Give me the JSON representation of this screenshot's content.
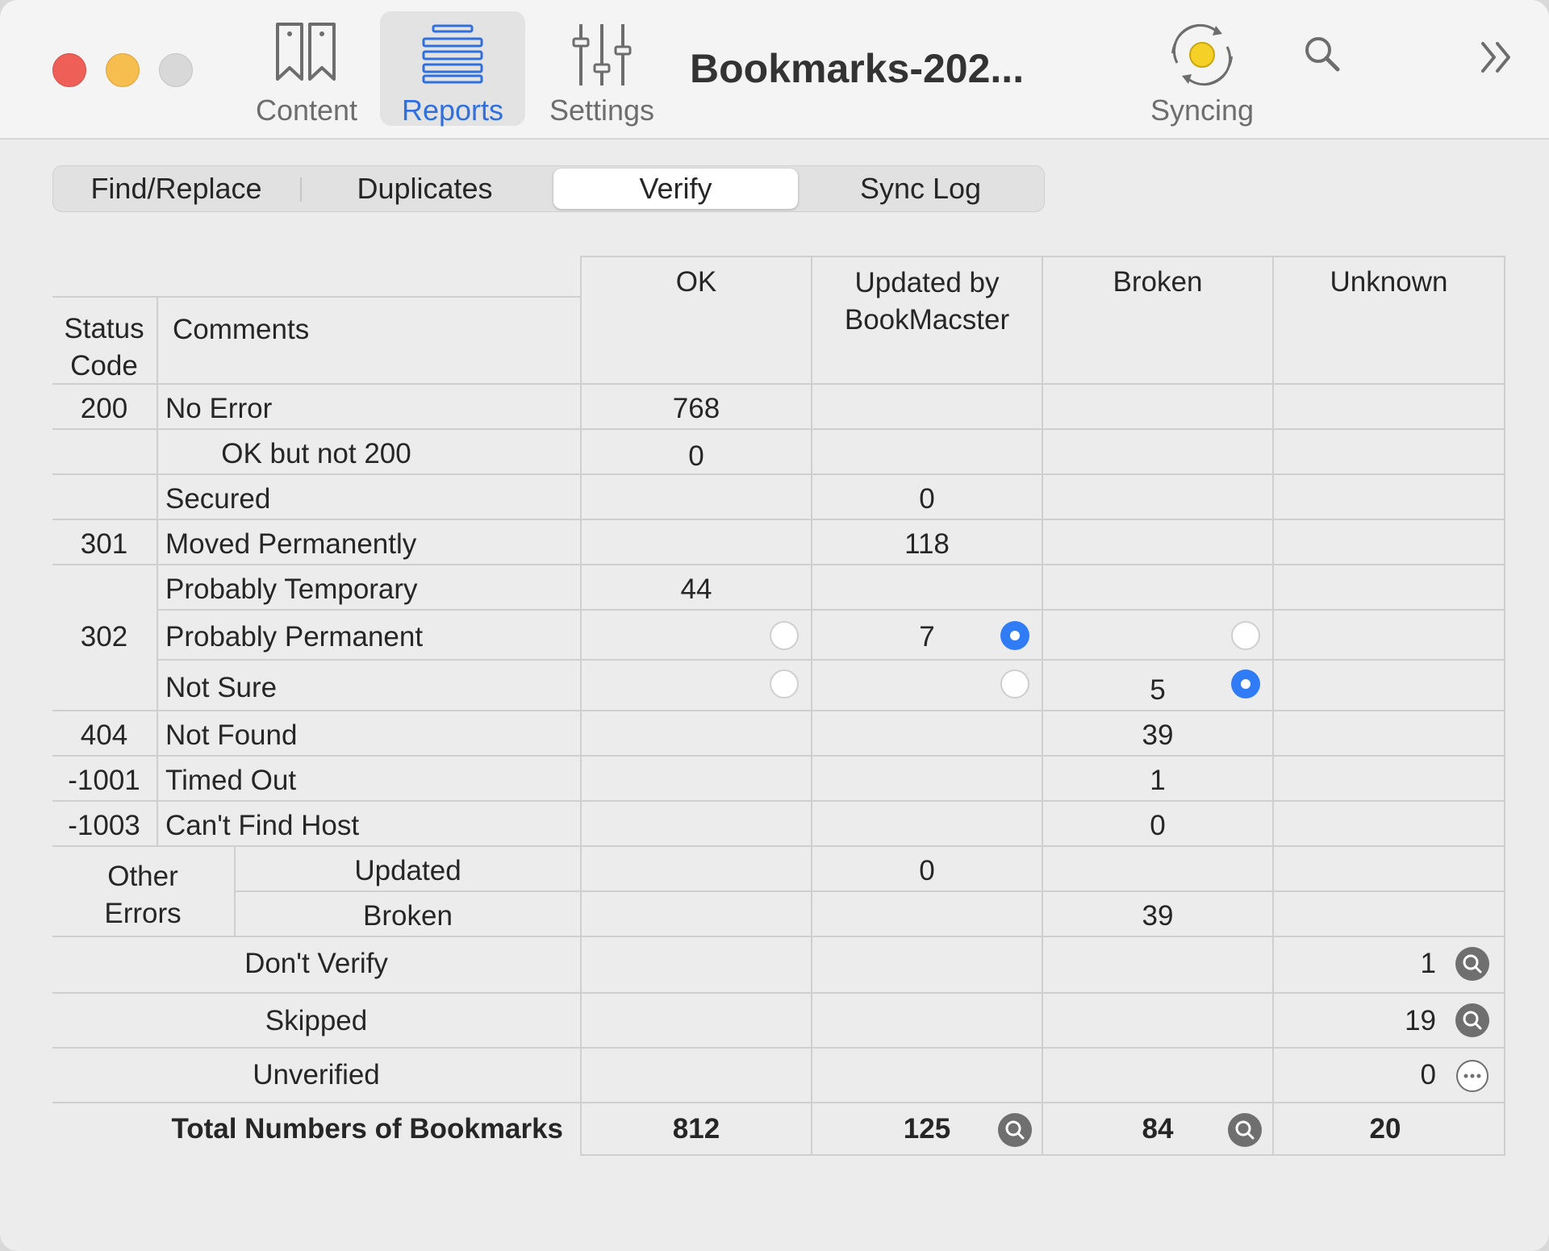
{
  "toolbar": {
    "content_label": "Content",
    "reports_label": "Reports",
    "settings_label": "Settings",
    "doc_title": "Bookmarks-202...",
    "syncing_label": "Syncing",
    "accent": "#2f6fde"
  },
  "tabs": [
    "Find/Replace",
    "Duplicates",
    "Verify",
    "Sync Log"
  ],
  "active_tab": "Verify",
  "table": {
    "columns": {
      "status_code": "Status\nCode",
      "comments": "Comments",
      "ok": "OK",
      "updated": "Updated by\nBookMacster",
      "broken": "Broken",
      "unknown": "Unknown"
    },
    "rows": [
      {
        "code": "200",
        "comment": "No Error",
        "ok": "768"
      },
      {
        "comment": "OK but not 200",
        "ok": "0"
      },
      {
        "comment": "Secured",
        "updated": "0"
      },
      {
        "code": "301",
        "comment": "Moved Permanently",
        "updated": "118"
      },
      {
        "code": "302",
        "comment": "Probably Temporary",
        "ok": "44"
      },
      {
        "comment": "Probably Permanent",
        "updated": "7"
      },
      {
        "comment": "Not Sure",
        "broken": "5"
      },
      {
        "code": "404",
        "comment": "Not Found",
        "broken": "39"
      },
      {
        "code": "-1001",
        "comment": "Timed Out",
        "broken": "1"
      },
      {
        "code": "-1003",
        "comment": "Can't Find Host",
        "broken": "0"
      },
      {
        "group": "Other\nErrors",
        "comment": "Updated",
        "updated": "0"
      },
      {
        "comment": "Broken",
        "broken": "39"
      },
      {
        "comment": "Don't Verify",
        "unknown": "1"
      },
      {
        "comment": "Skipped",
        "unknown": "19"
      },
      {
        "comment": "Unverified",
        "unknown": "0"
      }
    ],
    "totals": {
      "label": "Total Numbers of Bookmarks",
      "ok": "812",
      "updated": "125",
      "broken": "84",
      "unknown": "20"
    }
  },
  "radio_state": {
    "probably_permanent": "updated",
    "not_sure": "broken",
    "color": "#2f7cf6"
  }
}
